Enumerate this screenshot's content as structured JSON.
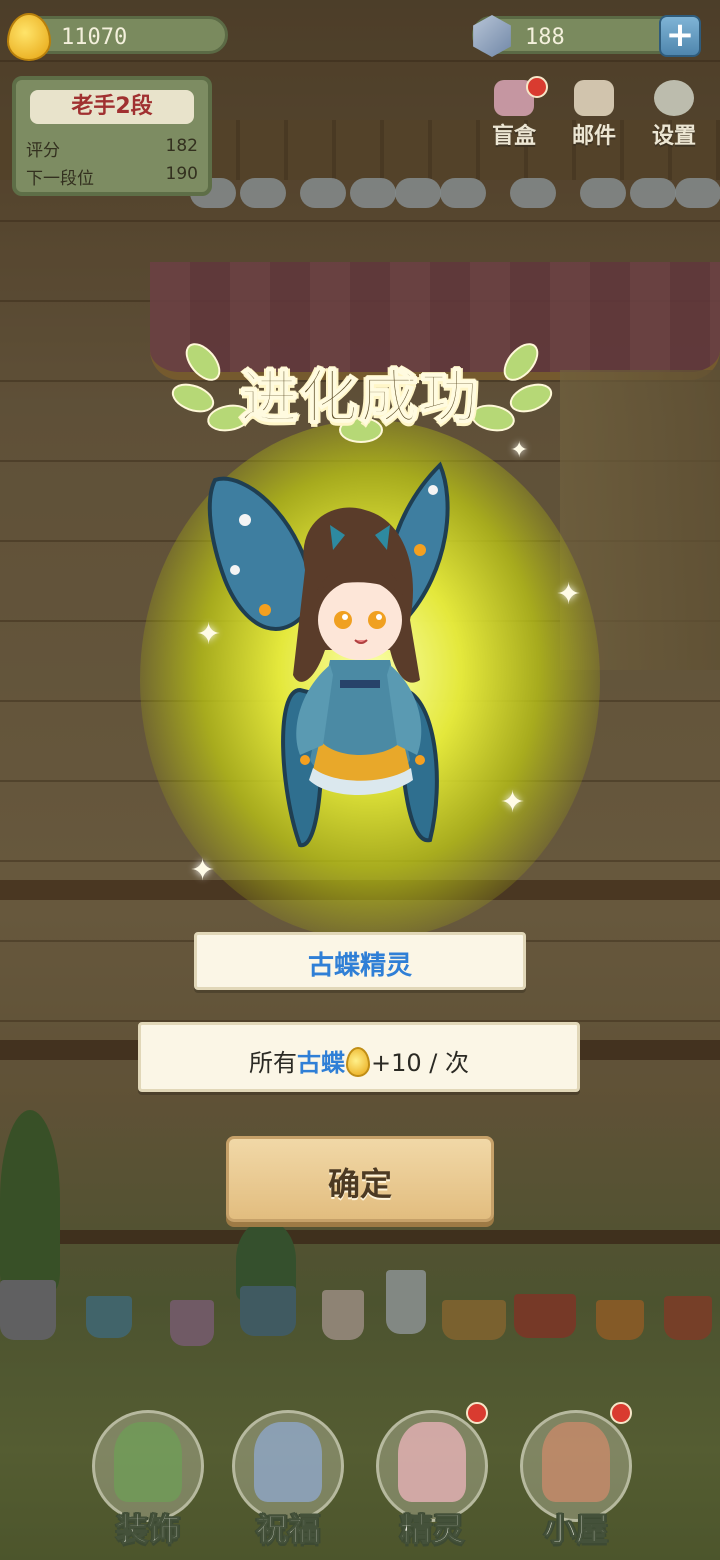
{
  "hud": {
    "coins": "11070",
    "gems": "188",
    "rank": {
      "title": "老手2段",
      "score_label": "评分",
      "score_value": "182",
      "next_label": "下一段位",
      "next_value": "190"
    },
    "menu": [
      {
        "label": "盲盒",
        "icon": "gift-icon"
      },
      {
        "label": "邮件",
        "icon": "mail-icon"
      },
      {
        "label": "设置",
        "icon": "gear-icon"
      }
    ]
  },
  "modal": {
    "banner": "进化成功",
    "fairy_name": "古蝶精灵",
    "effect_prefix": "所有",
    "effect_target": "古蝶",
    "effect_amount": "+10",
    "effect_suffix": "/ 次",
    "confirm_label": "确定"
  },
  "nav": [
    {
      "label": "装饰",
      "icon": "plant-icon"
    },
    {
      "label": "祝福",
      "icon": "blessing-icon"
    },
    {
      "label": "精灵",
      "icon": "fairy-icon"
    },
    {
      "label": "小屋",
      "icon": "house-icon"
    }
  ],
  "colors": {
    "glow": "#eef03c",
    "name_blue": "#2f7fd6",
    "button": "#e6c387"
  }
}
